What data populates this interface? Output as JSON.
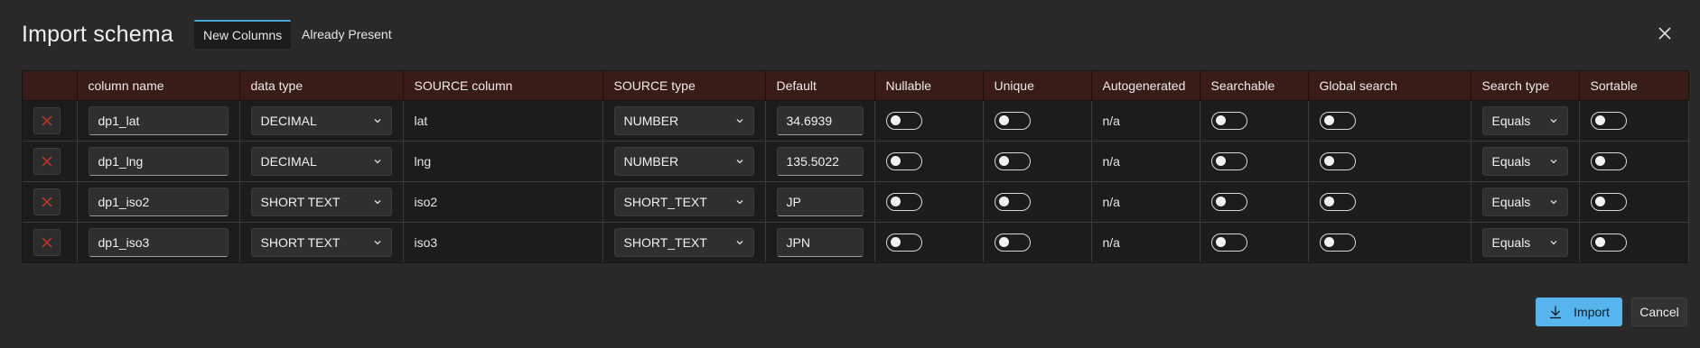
{
  "dialog": {
    "title": "Import schema",
    "tabs": [
      {
        "label": "New Columns",
        "active": true
      },
      {
        "label": "Already Present",
        "active": false
      }
    ]
  },
  "table": {
    "headers": [
      "",
      "column name",
      "data type",
      "SOURCE column",
      "SOURCE type",
      "Default",
      "Nullable",
      "Unique",
      "Autogenerated",
      "Searchable",
      "Global search",
      "Search type",
      "Sortable"
    ],
    "rows": [
      {
        "column_name": "dp1_lat",
        "data_type": "DECIMAL",
        "source_column": "lat",
        "source_type": "NUMBER",
        "default": "34.6939",
        "nullable": false,
        "unique": false,
        "autogenerated": "n/a",
        "searchable": false,
        "global_search": false,
        "search_type": "Equals",
        "sortable": false
      },
      {
        "column_name": "dp1_lng",
        "data_type": "DECIMAL",
        "source_column": "lng",
        "source_type": "NUMBER",
        "default": "135.5022",
        "nullable": false,
        "unique": false,
        "autogenerated": "n/a",
        "searchable": false,
        "global_search": false,
        "search_type": "Equals",
        "sortable": false
      },
      {
        "column_name": "dp1_iso2",
        "data_type": "SHORT TEXT",
        "source_column": "iso2",
        "source_type": "SHORT_TEXT",
        "default": "JP",
        "nullable": false,
        "unique": false,
        "autogenerated": "n/a",
        "searchable": false,
        "global_search": false,
        "search_type": "Equals",
        "sortable": false
      },
      {
        "column_name": "dp1_iso3",
        "data_type": "SHORT TEXT",
        "source_column": "iso3",
        "source_type": "SHORT_TEXT",
        "default": "JPN",
        "nullable": false,
        "unique": false,
        "autogenerated": "n/a",
        "searchable": false,
        "global_search": false,
        "search_type": "Equals",
        "sortable": false
      }
    ]
  },
  "footer": {
    "import_label": "Import",
    "cancel_label": "Cancel"
  },
  "icons": {
    "close": "close-icon",
    "delete": "x-icon",
    "chevron": "chevron-down-icon",
    "import": "download-icon"
  },
  "colors": {
    "background": "#292929",
    "header_row": "#3a1c16",
    "accent": "#58b4ec",
    "delete_x": "#c0392b"
  }
}
